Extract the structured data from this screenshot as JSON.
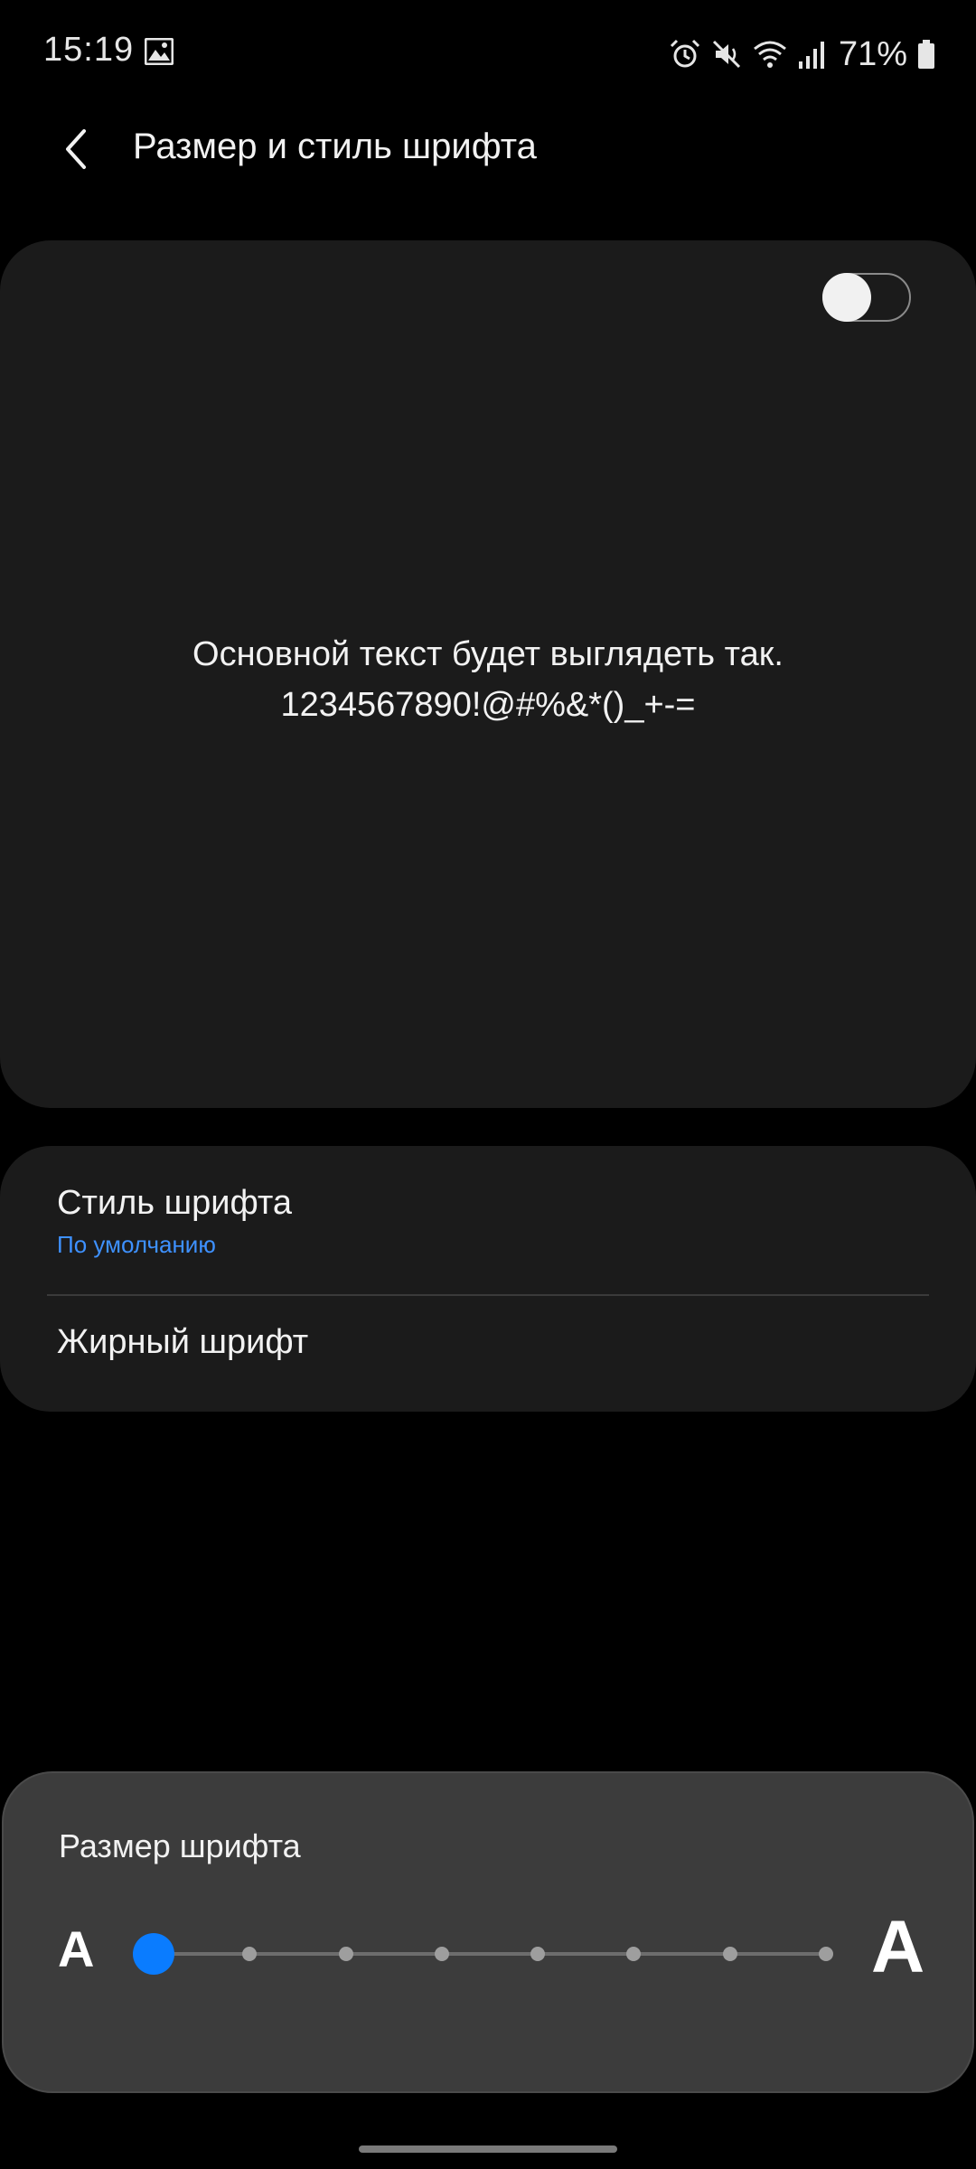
{
  "status_bar": {
    "time": "15:19",
    "battery": "71%",
    "icons": [
      "gallery-icon",
      "alarm-icon",
      "mute-icon",
      "wifi-icon",
      "signal-icon",
      "battery-icon"
    ]
  },
  "app_bar": {
    "title": "Размер и стиль шрифта",
    "back_icon": "chevron-left-icon"
  },
  "preview": {
    "line1": "Основной текст будет выглядеть так.",
    "line2": "1234567890!@#%&*()_+-="
  },
  "settings": {
    "font_style": {
      "title": "Стиль шрифта",
      "value": "По умолчанию"
    },
    "bold_font": {
      "title": "Жирный шрифт",
      "enabled": false
    }
  },
  "font_size": {
    "title": "Размер шрифта",
    "small_label": "A",
    "large_label": "A",
    "steps": 8,
    "selected_step": 1
  },
  "colors": {
    "background": "#000000",
    "card": "#1b1b1b",
    "accent": "#0a7cff",
    "subtitle": "#3e91ff",
    "panel": "#3c3c3c"
  }
}
